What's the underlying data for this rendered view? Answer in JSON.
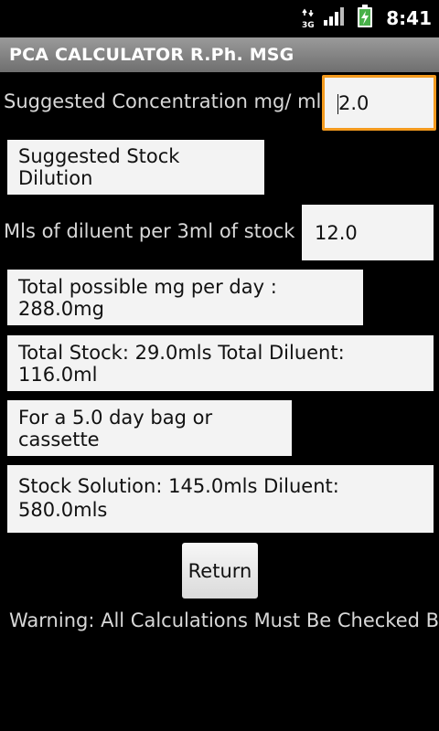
{
  "status_bar": {
    "network": "3G",
    "time": "8:41",
    "icons": [
      "network-3g-icon",
      "signal-icon",
      "battery-charging-icon"
    ]
  },
  "title_bar": {
    "title": "PCA CALCULATOR R.Ph. MSG"
  },
  "concentration": {
    "label": "Suggested Concentration mg/ ml",
    "value": "2.0"
  },
  "stock_dilution_heading": "Suggested Stock Dilution",
  "diluent": {
    "label": "Mls of diluent per  3ml of stock",
    "value": "12.0"
  },
  "results": {
    "total_mg_per_day": "Total possible mg per day : 288.0mg",
    "total_stock_diluent": "Total Stock: 29.0mls  Total Diluent: 116.0ml",
    "day_bag": "For a 5.0 day bag or cassette",
    "stock_solution": "Stock Solution: 145.0mls  Diluent: 580.0mls"
  },
  "return_button": "Return",
  "warning": "Warning: All Calculations Must Be Checked By",
  "colors": {
    "background": "#000000",
    "title_bar": "#8a8a8a",
    "focus_border": "#f39a1e",
    "panel": "#f3f3f3"
  }
}
